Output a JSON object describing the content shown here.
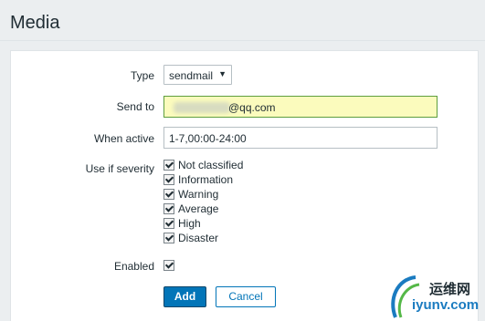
{
  "page": {
    "title": "Media"
  },
  "form": {
    "type": {
      "label": "Type",
      "selected": "sendmail"
    },
    "send_to": {
      "label": "Send to",
      "value_visible": "@qq.com"
    },
    "when_active": {
      "label": "When active",
      "value": "1-7,00:00-24:00"
    },
    "severity": {
      "label": "Use if severity",
      "options": [
        {
          "label": "Not classified",
          "checked": true
        },
        {
          "label": "Information",
          "checked": true
        },
        {
          "label": "Warning",
          "checked": true
        },
        {
          "label": "Average",
          "checked": true
        },
        {
          "label": "High",
          "checked": true
        },
        {
          "label": "Disaster",
          "checked": true
        }
      ]
    },
    "enabled": {
      "label": "Enabled",
      "checked": true
    }
  },
  "buttons": {
    "add": "Add",
    "cancel": "Cancel"
  },
  "watermark": {
    "line1": "运维网",
    "line2": "iyunv.com"
  },
  "colors": {
    "primary": "#0275b8",
    "highlight_input": "#fbfbbd"
  }
}
